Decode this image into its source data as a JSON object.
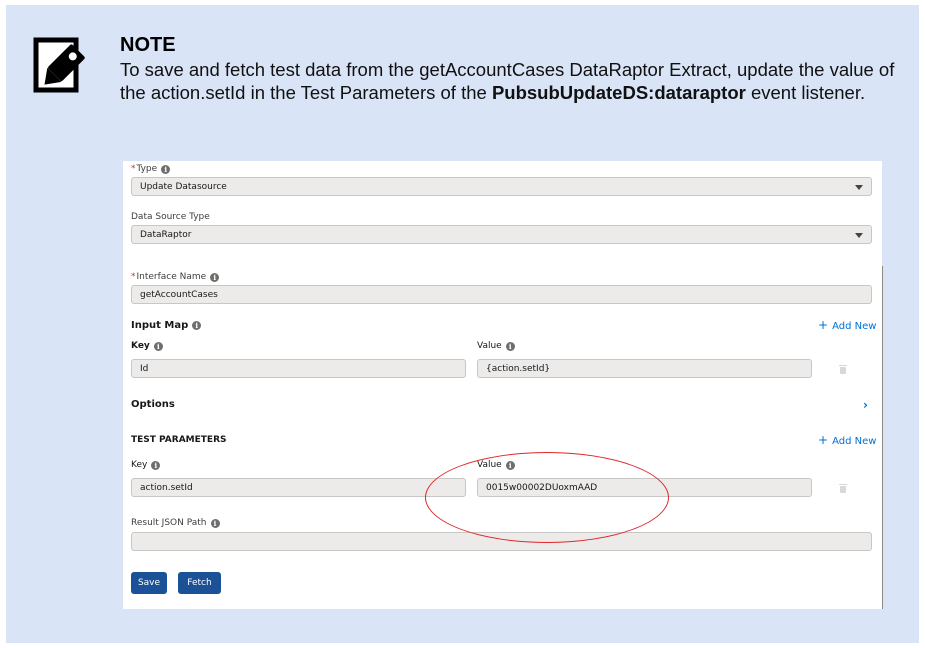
{
  "note": {
    "title": "NOTE",
    "text_before": "To save and fetch test data from the getAccountCases DataRaptor Extract, update the value of the action.setId in the Test Parameters of the ",
    "text_bold": "PubsubUpdateDS:dataraptor",
    "text_after": " event listener.",
    "icon": "note-pencil-icon"
  },
  "form": {
    "type": {
      "label": "Type",
      "required_mark": "*",
      "value": "Update Datasource"
    },
    "data_source_type": {
      "label": "Data Source Type",
      "value": "DataRaptor"
    },
    "interface_name": {
      "label": "Interface Name",
      "required_mark": "*",
      "value": "getAccountCases"
    },
    "input_map": {
      "title": "Input Map",
      "add_label": "Add New",
      "key_header": "Key",
      "value_header": "Value",
      "rows": [
        {
          "key": "Id",
          "value": "{action.setId}"
        }
      ]
    },
    "options": {
      "title": "Options"
    },
    "test_parameters": {
      "title": "TEST PARAMETERS",
      "add_label": "Add New",
      "key_header": "Key",
      "value_header": "Value",
      "rows": [
        {
          "key": "action.setId",
          "value": "0015w00002DUoxmAAD"
        }
      ]
    },
    "result_json_path": {
      "label": "Result JSON Path",
      "value": ""
    },
    "buttons": {
      "save": "Save",
      "fetch": "Fetch"
    }
  },
  "colors": {
    "note_background": "#d9e4f7",
    "button": "#1b5297",
    "link": "#0070d2",
    "highlight": "#e0262a"
  }
}
